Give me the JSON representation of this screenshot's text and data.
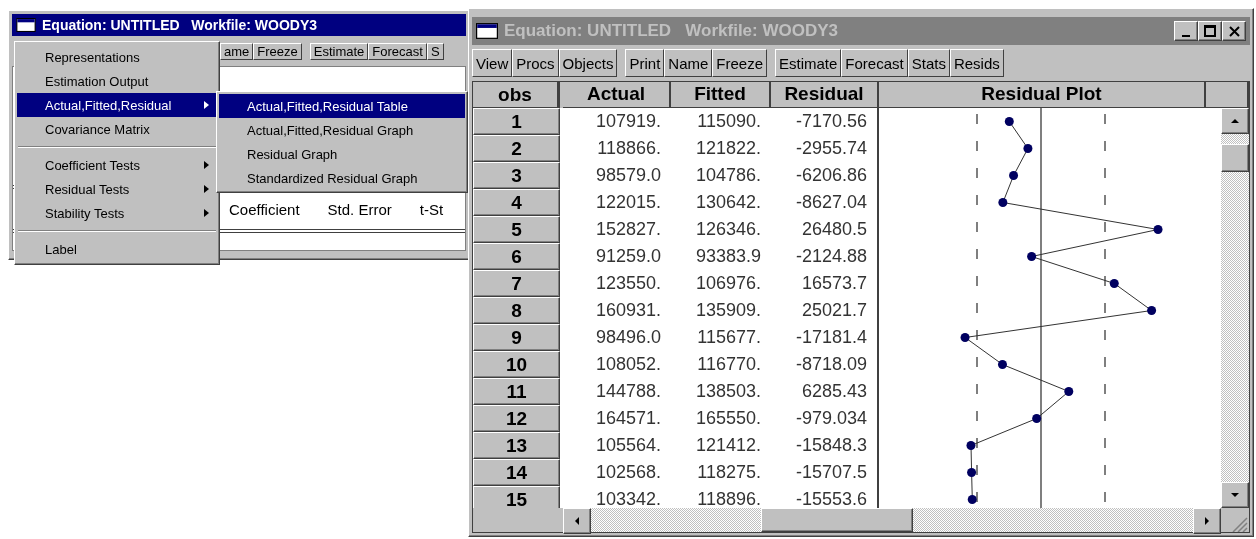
{
  "left_window": {
    "title": "Equation: UNTITLED   Workfile: WOODY3",
    "active": true,
    "toolbar": [
      "ame",
      "Freeze",
      "Estimate",
      "Forecast",
      "S"
    ],
    "menu": [
      {
        "kind": "item",
        "label": "Representations",
        "selected": false
      },
      {
        "kind": "item",
        "label": "Estimation Output",
        "selected": false
      },
      {
        "kind": "submenu",
        "label": "Actual,Fitted,Residual",
        "selected": true
      },
      {
        "kind": "item",
        "label": "Covariance Matrix",
        "selected": false
      },
      {
        "kind": "separator"
      },
      {
        "kind": "submenu",
        "label": "Coefficient Tests",
        "selected": false
      },
      {
        "kind": "submenu",
        "label": "Residual Tests",
        "selected": false
      },
      {
        "kind": "submenu",
        "label": "Stability Tests",
        "selected": false
      },
      {
        "kind": "separator"
      },
      {
        "kind": "item",
        "label": "Label",
        "selected": false
      }
    ],
    "submenu": [
      {
        "label": "Actual,Fitted,Residual Table",
        "selected": true
      },
      {
        "label": "Actual,Fitted,Residual Graph",
        "selected": false
      },
      {
        "label": "Residual Graph",
        "selected": false
      },
      {
        "label": "Standardized Residual Graph",
        "selected": false
      }
    ],
    "table_header": [
      "Coefficient",
      "Std. Error",
      "t-St"
    ]
  },
  "right_window": {
    "title": "Equation: UNTITLED   Workfile: WOODY3",
    "active": false,
    "toolbar": [
      [
        "View",
        "Procs",
        "Objects"
      ],
      [
        "Print",
        "Name",
        "Freeze"
      ],
      [
        "Estimate",
        "Forecast",
        "Stats",
        "Resids"
      ]
    ],
    "columns": [
      "obs",
      "Actual",
      "Fitted",
      "Residual",
      "Residual Plot"
    ],
    "rows": [
      {
        "obs": "1",
        "actual": "107919.",
        "fitted": "115090.",
        "residual": "-7170.56"
      },
      {
        "obs": "2",
        "actual": "118866.",
        "fitted": "121822.",
        "residual": "-2955.74"
      },
      {
        "obs": "3",
        "actual": "98579.0",
        "fitted": "104786.",
        "residual": "-6206.86"
      },
      {
        "obs": "4",
        "actual": "122015.",
        "fitted": "130642.",
        "residual": "-8627.04"
      },
      {
        "obs": "5",
        "actual": "152827.",
        "fitted": "126346.",
        "residual": "26480.5"
      },
      {
        "obs": "6",
        "actual": "91259.0",
        "fitted": "93383.9",
        "residual": "-2124.88"
      },
      {
        "obs": "7",
        "actual": "123550.",
        "fitted": "106976.",
        "residual": "16573.7"
      },
      {
        "obs": "8",
        "actual": "160931.",
        "fitted": "135909.",
        "residual": "25021.7"
      },
      {
        "obs": "9",
        "actual": "98496.0",
        "fitted": "115677.",
        "residual": "-17181.4"
      },
      {
        "obs": "10",
        "actual": "108052.",
        "fitted": "116770.",
        "residual": "-8718.09"
      },
      {
        "obs": "11",
        "actual": "144788.",
        "fitted": "138503.",
        "residual": "6285.43"
      },
      {
        "obs": "12",
        "actual": "164571.",
        "fitted": "165550.",
        "residual": "-979.034"
      },
      {
        "obs": "13",
        "actual": "105564.",
        "fitted": "121412.",
        "residual": "-15848.3"
      },
      {
        "obs": "14",
        "actual": "102568.",
        "fitted": "118275.",
        "residual": "-15707.5"
      },
      {
        "obs": "15",
        "actual": "103342.",
        "fitted": "118896.",
        "residual": "-15553.6"
      }
    ]
  }
}
